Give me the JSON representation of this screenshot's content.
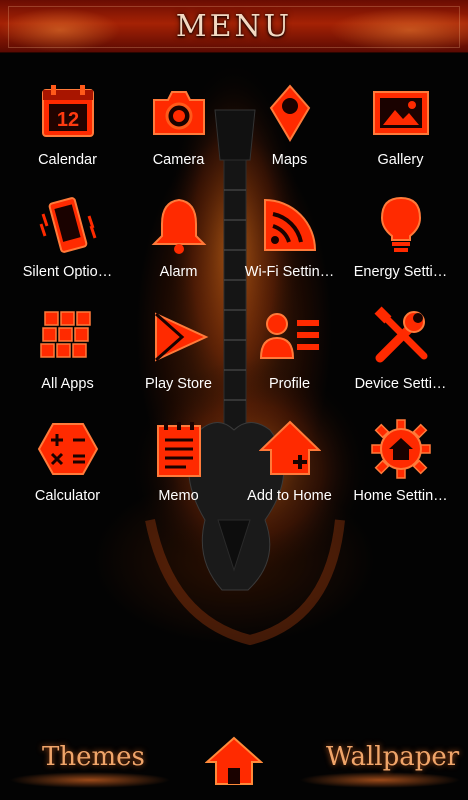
{
  "header": {
    "title": "MENU"
  },
  "apps": [
    {
      "label": "Calendar",
      "icon": "calendar-icon",
      "date": "12"
    },
    {
      "label": "Camera",
      "icon": "camera-icon"
    },
    {
      "label": "Maps",
      "icon": "map-pin-icon"
    },
    {
      "label": "Gallery",
      "icon": "gallery-icon"
    },
    {
      "label": "Silent Optio…",
      "icon": "vibrate-phone-icon"
    },
    {
      "label": "Alarm",
      "icon": "bell-icon"
    },
    {
      "label": "Wi-Fi Settin…",
      "icon": "wifi-icon"
    },
    {
      "label": "Energy Setti…",
      "icon": "lightbulb-icon"
    },
    {
      "label": "All Apps",
      "icon": "apps-grid-icon"
    },
    {
      "label": "Play Store",
      "icon": "play-store-icon"
    },
    {
      "label": "Profile",
      "icon": "profile-icon"
    },
    {
      "label": "Device Setti…",
      "icon": "tools-icon"
    },
    {
      "label": "Calculator",
      "icon": "calculator-icon"
    },
    {
      "label": "Memo",
      "icon": "memo-icon"
    },
    {
      "label": "Add to Home",
      "icon": "add-home-icon"
    },
    {
      "label": "Home Settin…",
      "icon": "home-gear-icon"
    }
  ],
  "dock": {
    "left": "Themes",
    "right": "Wallpaper",
    "center_icon": "home-icon"
  },
  "colors": {
    "accent": "#ff2a00",
    "accent_dark": "#8a0c00",
    "label": "#ffffff",
    "dock_text": "#f0a56a"
  }
}
